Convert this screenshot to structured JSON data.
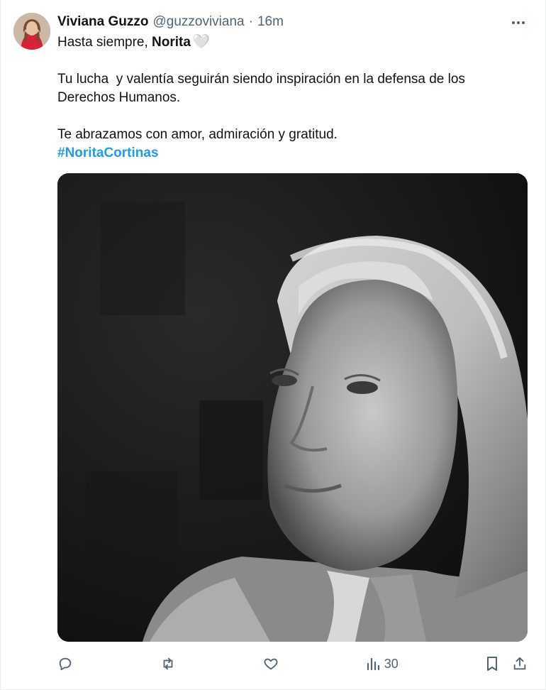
{
  "author": {
    "name": "Viviana Guzzo",
    "handle": "@guzzoviviana",
    "separator": "·",
    "time": "16m"
  },
  "tweet": {
    "line1_prefix": "Hasta siempre, ",
    "line1_bold": "Norita",
    "line1_emoji": "🤍",
    "para2_line1": "Tu lucha  y valentía seguirán siendo inspiración en la defensa de los",
    "para2_line2": "Derechos Humanos.",
    "para3": "Te abrazamos con amor, admiración y gratitud.",
    "hashtag": "#NoritaCortinas"
  },
  "actions": {
    "views_count": "30",
    "reply_icon": "reply-icon",
    "retweet_icon": "retweet-icon",
    "like_icon": "like-icon",
    "views_icon": "views-icon",
    "bookmark_icon": "bookmark-icon",
    "share_icon": "share-icon"
  },
  "colors": {
    "hashtag": "#1d9bf0",
    "secondary_text": "#536471",
    "primary_text": "#0f1419"
  }
}
